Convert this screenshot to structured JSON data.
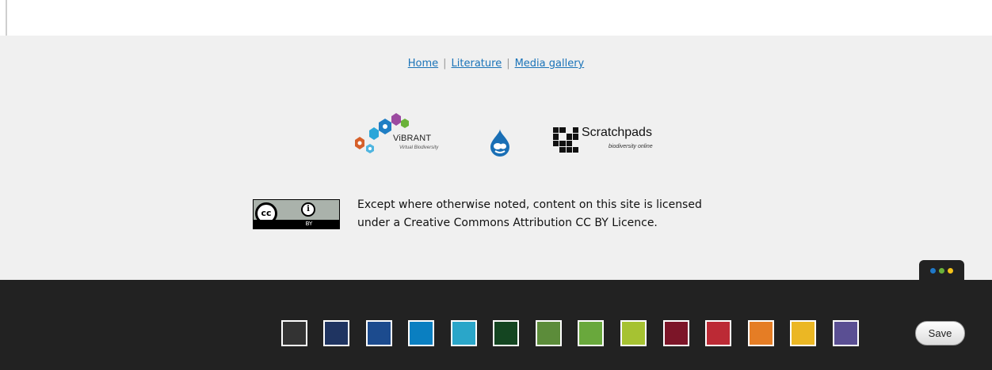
{
  "footer": {
    "links": [
      {
        "label": "Home"
      },
      {
        "label": "Literature"
      },
      {
        "label": "Media gallery"
      }
    ],
    "separator": "|",
    "logos": {
      "vibrant": {
        "title": "ViBRANT",
        "subtitle": "Virtual Biodiversity"
      },
      "drupal": {
        "icon": "drupal-drop-icon"
      },
      "scratchpads": {
        "title": "Scratchpads",
        "subtitle": "biodiversity online"
      }
    },
    "license": {
      "badge_cc": "cc",
      "badge_by_icon": "i",
      "badge_by": "BY",
      "text_line1": "Except where otherwise noted, content on this site is licensed",
      "text_line2": "under a Creative Commons Attribution CC BY Licence."
    }
  },
  "color_toolbar": {
    "tab_dot_colors": [
      "#1f78c8",
      "#6bb23a",
      "#f4c21a"
    ],
    "swatches": [
      "#333333",
      "#1f3461",
      "#1c4b8e",
      "#0a7fc1",
      "#2aa6c9",
      "#144521",
      "#5c8c3a",
      "#69a83c",
      "#a6c232",
      "#7c1528",
      "#bc2a35",
      "#e57d25",
      "#ebb724",
      "#5a4f93"
    ],
    "save_label": "Save"
  }
}
